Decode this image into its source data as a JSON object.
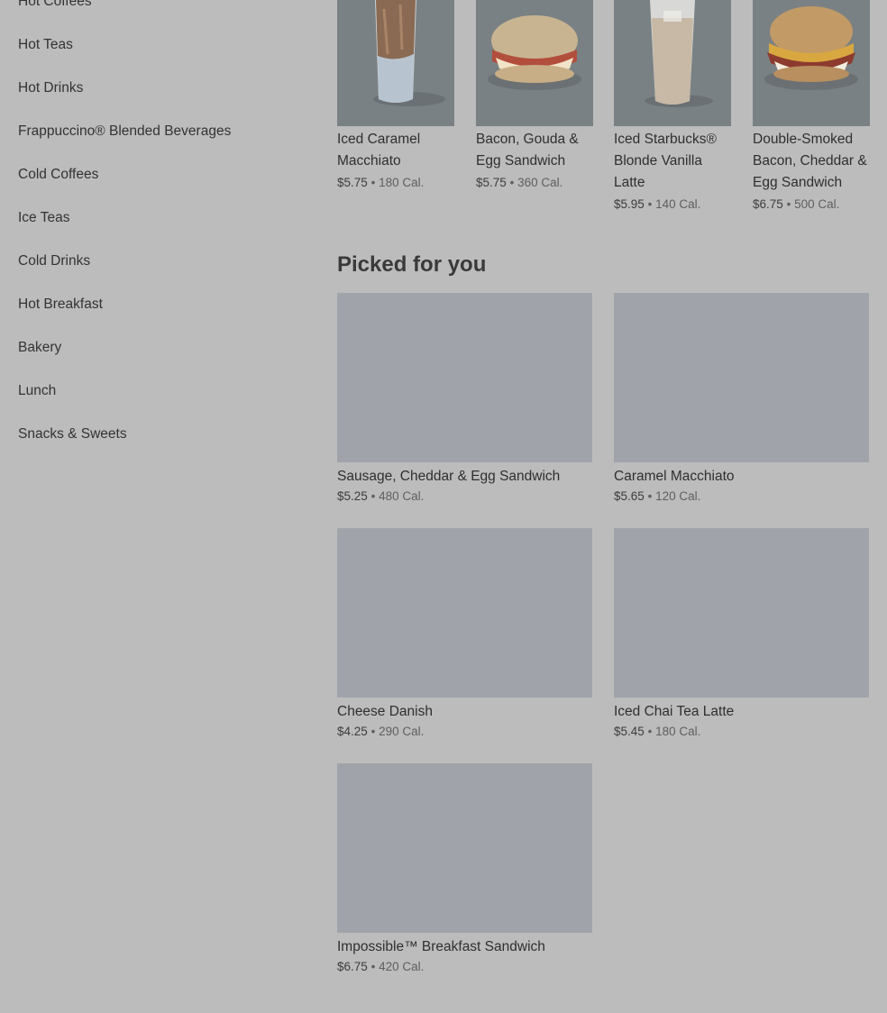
{
  "sidebar": {
    "items": [
      "Hot Coffees",
      "Hot Teas",
      "Hot Drinks",
      "Frappuccino® Blended Beverages",
      "Cold Coffees",
      "Ice Teas",
      "Cold Drinks",
      "Hot Breakfast",
      "Bakery",
      "Lunch",
      "Snacks & Sweets"
    ]
  },
  "top_items": [
    {
      "name_lines": [
        "Iced Caramel",
        "Macchiato"
      ],
      "price": "$5.75",
      "sep": "•",
      "cal": "180 Cal.",
      "image": "iced-caramel-macchiato-image"
    },
    {
      "name_lines": [
        "Bacon, Gouda &",
        "Egg Sandwich"
      ],
      "price": "$5.75",
      "sep": "•",
      "cal": "360 Cal.",
      "image": "bacon-gouda-sandwich-image"
    },
    {
      "name_lines": [
        "Iced Starbucks®",
        "Blonde Vanilla",
        "Latte"
      ],
      "price": "$5.95",
      "sep": "•",
      "cal": "140 Cal.",
      "image": "iced-blonde-vanilla-latte-image"
    },
    {
      "name_lines": [
        "Double-Smoked",
        "Bacon, Cheddar &",
        "Egg Sandwich"
      ],
      "price": "$6.75",
      "sep": "•",
      "cal": "500 Cal.",
      "image": "double-smoked-bacon-sandwich-image"
    }
  ],
  "picked": {
    "title": "Picked for you",
    "items": [
      {
        "name": "Sausage, Cheddar & Egg Sandwich",
        "price": "$5.25",
        "sep": "•",
        "cal": "480 Cal."
      },
      {
        "name": "Caramel Macchiato",
        "price": "$5.65",
        "sep": "•",
        "cal": "120 Cal."
      },
      {
        "name": "Cheese Danish",
        "price": "$4.25",
        "sep": "•",
        "cal": "290 Cal."
      },
      {
        "name": "Iced Chai Tea Latte",
        "price": "$5.45",
        "sep": "•",
        "cal": "180 Cal."
      },
      {
        "name": "Impossible™ Breakfast Sandwich",
        "price": "$6.75",
        "sep": "•",
        "cal": "420 Cal."
      }
    ]
  },
  "colors": {
    "overlay_background": "#bcbcbc",
    "placeholder_image": "#a0a3aa",
    "thumb_background": "#7a8184"
  }
}
